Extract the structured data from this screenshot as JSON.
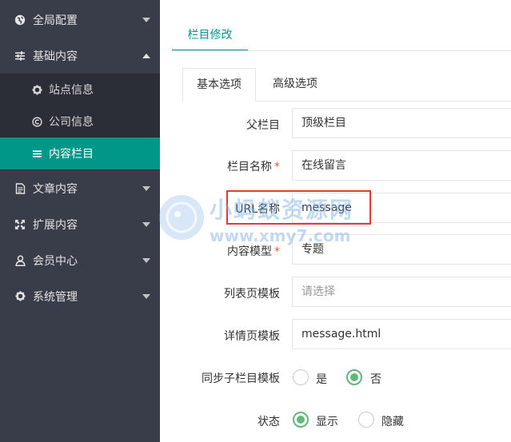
{
  "sidebar": {
    "items": [
      {
        "label": "全局配置",
        "icon": "globe-icon"
      },
      {
        "label": "基础内容",
        "icon": "sliders-icon"
      },
      {
        "label": "文章内容",
        "icon": "file-icon"
      },
      {
        "label": "扩展内容",
        "icon": "expand-icon"
      },
      {
        "label": "会员中心",
        "icon": "user-icon"
      },
      {
        "label": "系统管理",
        "icon": "gear-icon"
      }
    ],
    "sub_items": [
      {
        "label": "站点信息",
        "icon": "gear-icon"
      },
      {
        "label": "公司信息",
        "icon": "copyright-icon"
      },
      {
        "label": "内容栏目",
        "icon": "list-icon"
      }
    ]
  },
  "main": {
    "page_tab": "栏目修改",
    "tabs": [
      "基本选项",
      "高级选项"
    ],
    "form": {
      "parent_label": "父栏目",
      "parent_value": "顶级栏目",
      "name_label": "栏目名称",
      "name_value": "在线留言",
      "required_mark": "*",
      "url_label": "URL名称",
      "url_value": "message",
      "model_label": "内容模型",
      "model_value": "专题",
      "list_tpl_label": "列表页模板",
      "list_tpl_placeholder": "请选择",
      "detail_tpl_label": "详情页模板",
      "detail_tpl_value": "message.html",
      "sync_label": "同步子栏目模板",
      "sync_yes": "是",
      "sync_no": "否",
      "status_label": "状态",
      "status_show": "显示",
      "status_hide": "隐藏"
    }
  },
  "watermark": {
    "line1": "小蚂蚁资源网",
    "line2": "www.xmy7.com"
  },
  "colors": {
    "sidebar_bg": "#393d49",
    "submenu_bg": "#2b2e37",
    "accent": "#009688",
    "radio_on": "#5fb878",
    "required": "#ff5722",
    "highlight": "#e53935"
  }
}
